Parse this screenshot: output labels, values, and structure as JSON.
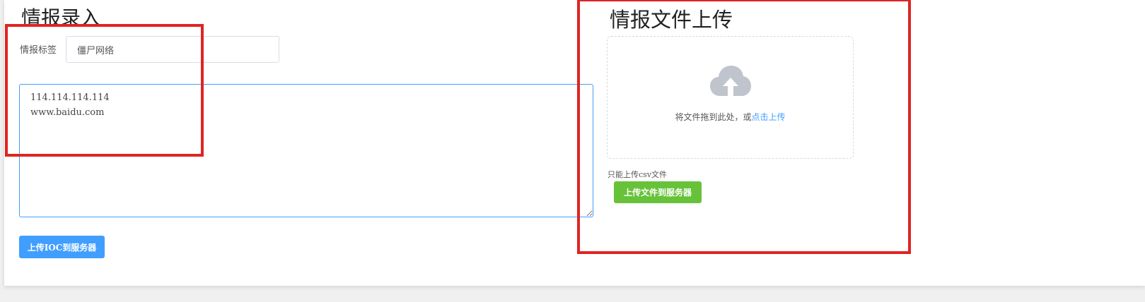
{
  "left_panel": {
    "title": "情报录入",
    "tag_label": "情报标签",
    "tag_value": "僵尸网络",
    "ioc_text": "114.114.114.114\nwww.baidu.com",
    "upload_button_label": "上传IOC到服务器"
  },
  "right_panel": {
    "title": "情报文件上传",
    "dropzone_text": "将文件拖到此处，或",
    "dropzone_link": "点击上传",
    "tip": "只能上传csv文件",
    "upload_button_label": "上传文件到服务器"
  },
  "colors": {
    "primary": "#409eff",
    "success": "#67c23a",
    "highlight": "#e02424",
    "icon_gray": "#c0c4cc"
  },
  "icons": {
    "upload": "cloud-upload-icon"
  }
}
